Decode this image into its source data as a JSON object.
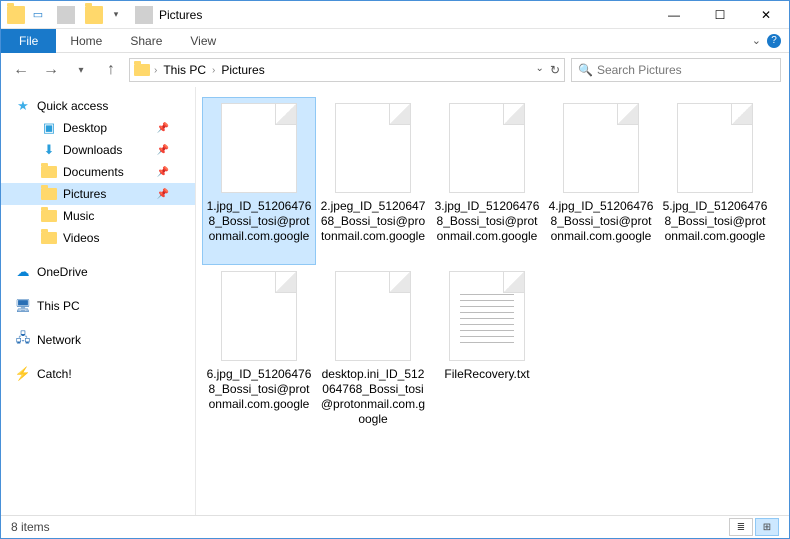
{
  "window": {
    "title": "Pictures"
  },
  "ribbon": {
    "file": "File",
    "tabs": [
      "Home",
      "Share",
      "View"
    ]
  },
  "nav": {
    "breadcrumb": [
      "This PC",
      "Pictures"
    ],
    "search_placeholder": "Search Pictures"
  },
  "sidebar": {
    "quick_access": {
      "label": "Quick access",
      "items": [
        "Desktop",
        "Downloads",
        "Documents",
        "Pictures",
        "Music",
        "Videos"
      ]
    },
    "onedrive": "OneDrive",
    "thispc": "This PC",
    "network": "Network",
    "catch": "Catch!"
  },
  "files": [
    {
      "name": "1.jpg_ID_512064768_Bossi_tosi@protonmail.com.google",
      "type": "blank",
      "selected": true
    },
    {
      "name": "2.jpeg_ID_512064768_Bossi_tosi@protonmail.com.google",
      "type": "blank",
      "selected": false
    },
    {
      "name": "3.jpg_ID_512064768_Bossi_tosi@protonmail.com.google",
      "type": "blank",
      "selected": false
    },
    {
      "name": "4.jpg_ID_512064768_Bossi_tosi@protonmail.com.google",
      "type": "blank",
      "selected": false
    },
    {
      "name": "5.jpg_ID_512064768_Bossi_tosi@protonmail.com.google",
      "type": "blank",
      "selected": false
    },
    {
      "name": "6.jpg_ID_512064768_Bossi_tosi@protonmail.com.google",
      "type": "blank",
      "selected": false
    },
    {
      "name": "desktop.ini_ID_512064768_Bossi_tosi@protonmail.com.google",
      "type": "blank",
      "selected": false
    },
    {
      "name": "FileRecovery.txt",
      "type": "text",
      "selected": false
    }
  ],
  "status": {
    "count": "8 items"
  },
  "colors": {
    "accent": "#1979ca",
    "selection": "#cde8ff"
  }
}
